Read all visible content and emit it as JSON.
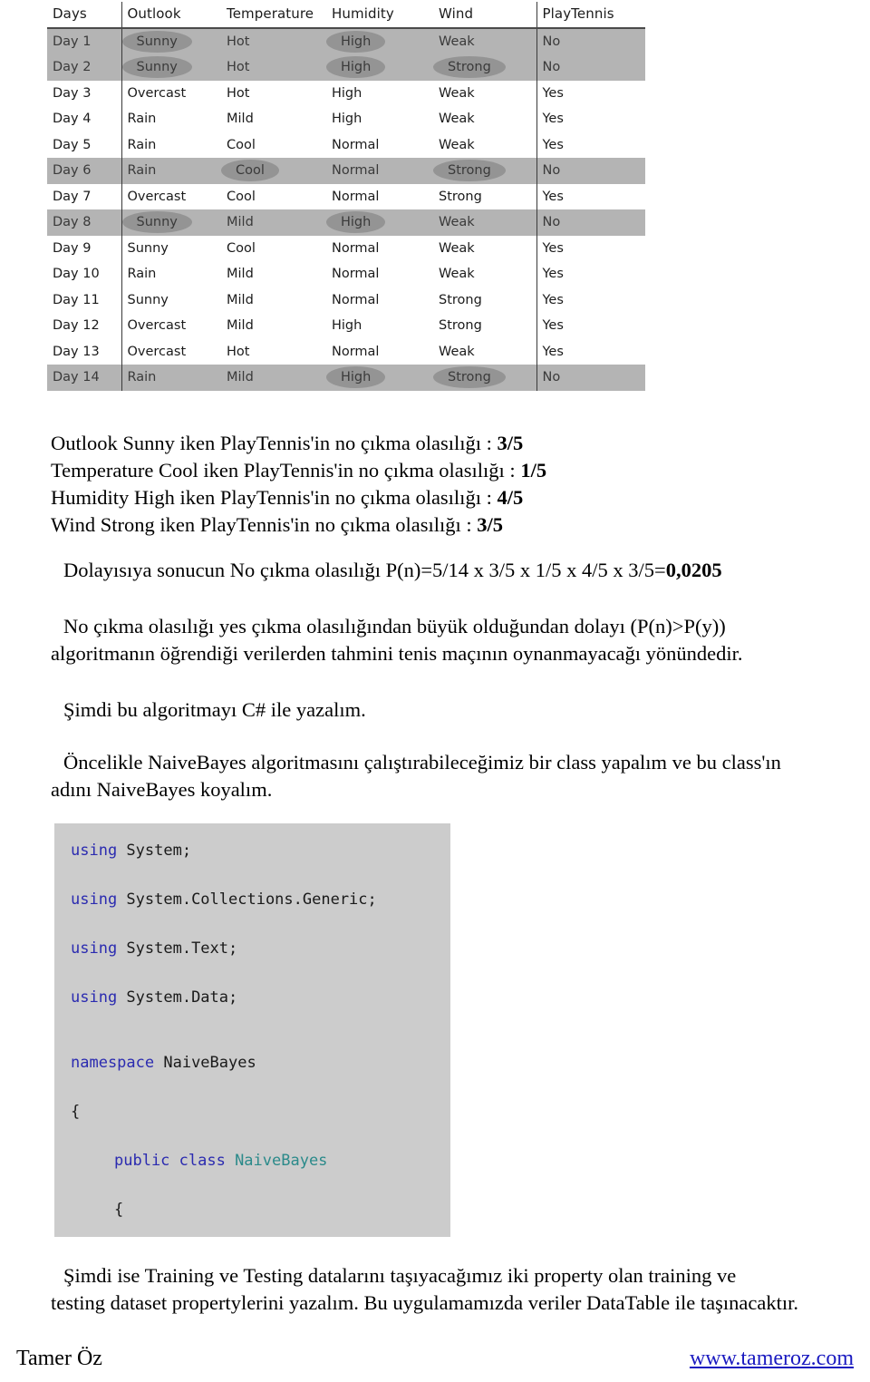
{
  "table": {
    "name": "play-tennis-dataset",
    "columns": [
      "Days",
      "Outlook",
      "Temperature",
      "Humidity",
      "Wind",
      "PlayTennis"
    ],
    "rows": [
      {
        "day": "Day 1",
        "outlook": "Sunny",
        "temperature": "Hot",
        "humidity": "High",
        "wind": "Weak",
        "play": "No",
        "highlight": true,
        "circled": [
          "outlook",
          "humidity"
        ]
      },
      {
        "day": "Day 2",
        "outlook": "Sunny",
        "temperature": "Hot",
        "humidity": "High",
        "wind": "Strong",
        "play": "No",
        "highlight": true,
        "circled": [
          "outlook",
          "humidity",
          "wind"
        ]
      },
      {
        "day": "Day 3",
        "outlook": "Overcast",
        "temperature": "Hot",
        "humidity": "High",
        "wind": "Weak",
        "play": "Yes",
        "highlight": false,
        "circled": []
      },
      {
        "day": "Day 4",
        "outlook": "Rain",
        "temperature": "Mild",
        "humidity": "High",
        "wind": "Weak",
        "play": "Yes",
        "highlight": false,
        "circled": []
      },
      {
        "day": "Day 5",
        "outlook": "Rain",
        "temperature": "Cool",
        "humidity": "Normal",
        "wind": "Weak",
        "play": "Yes",
        "highlight": false,
        "circled": []
      },
      {
        "day": "Day 6",
        "outlook": "Rain",
        "temperature": "Cool",
        "humidity": "Normal",
        "wind": "Strong",
        "play": "No",
        "highlight": true,
        "circled": [
          "temperature",
          "wind"
        ]
      },
      {
        "day": "Day 7",
        "outlook": "Overcast",
        "temperature": "Cool",
        "humidity": "Normal",
        "wind": "Strong",
        "play": "Yes",
        "highlight": false,
        "circled": []
      },
      {
        "day": "Day 8",
        "outlook": "Sunny",
        "temperature": "Mild",
        "humidity": "High",
        "wind": "Weak",
        "play": "No",
        "highlight": true,
        "circled": [
          "outlook",
          "humidity"
        ]
      },
      {
        "day": "Day 9",
        "outlook": "Sunny",
        "temperature": "Cool",
        "humidity": "Normal",
        "wind": "Weak",
        "play": "Yes",
        "highlight": false,
        "circled": []
      },
      {
        "day": "Day 10",
        "outlook": "Rain",
        "temperature": "Mild",
        "humidity": "Normal",
        "wind": "Weak",
        "play": "Yes",
        "highlight": false,
        "circled": []
      },
      {
        "day": "Day 11",
        "outlook": "Sunny",
        "temperature": "Mild",
        "humidity": "Normal",
        "wind": "Strong",
        "play": "Yes",
        "highlight": false,
        "circled": []
      },
      {
        "day": "Day 12",
        "outlook": "Overcast",
        "temperature": "Mild",
        "humidity": "High",
        "wind": "Strong",
        "play": "Yes",
        "highlight": false,
        "circled": []
      },
      {
        "day": "Day 13",
        "outlook": "Overcast",
        "temperature": "Hot",
        "humidity": "Normal",
        "wind": "Weak",
        "play": "Yes",
        "highlight": false,
        "circled": []
      },
      {
        "day": "Day 14",
        "outlook": "Rain",
        "temperature": "Mild",
        "humidity": "High",
        "wind": "Strong",
        "play": "No",
        "highlight": true,
        "circled": [
          "humidity",
          "wind"
        ]
      }
    ]
  },
  "facts": [
    {
      "text": "Outlook Sunny iken PlayTennis'in no çıkma olasılığı : ",
      "value": "3/5"
    },
    {
      "text": "Temperature Cool iken PlayTennis'in no çıkma olasılığı : ",
      "value": "1/5"
    },
    {
      "text": "Humidity High iken PlayTennis'in no çıkma olasılığı : ",
      "value": "4/5"
    },
    {
      "text": "Wind Strong iken PlayTennis'in no çıkma olasılığı : ",
      "value": "3/5"
    }
  ],
  "conclusion": {
    "text": "Dolayısıya sonucun No çıkma olasılığı P(n)=5/14 x 3/5 x 1/5 x 4/5 x 3/5=",
    "result": "0,0205"
  },
  "comparison": {
    "line1": "No çıkma olasılığı yes çıkma olasılığından büyük olduğundan dolayı (P(n)>P(y))",
    "line2": "algoritmanın öğrendiği verilerden tahmini tenis maçının oynanmayacağı yönündedir."
  },
  "now_csharp": "Şimdi bu algoritmayı C# ile yazalım.",
  "first_class": {
    "line1": "Öncelikle NaiveBayes algoritmasını çalıştırabileceğimiz bir class yapalım ve bu class'ın",
    "line2": "adını NaiveBayes koyalım."
  },
  "code": {
    "lines": [
      {
        "kw": "using ",
        "rest": "System;"
      },
      {
        "kw": "using ",
        "rest": "System.Collections.Generic;"
      },
      {
        "kw": "using ",
        "rest": "System.Text;"
      },
      {
        "kw": "using ",
        "rest": "System.Data;"
      },
      {
        "kw": "namespace ",
        "rest": "NaiveBayes"
      },
      {
        "kw": "",
        "rest": "{"
      },
      {
        "kw": "public class ",
        "rest": "NaiveBayes",
        "type": true
      },
      {
        "kw": "",
        "rest": "{"
      }
    ]
  },
  "closing": {
    "line1": "Şimdi ise Training ve Testing datalarını taşıyacağımız iki property olan training ve",
    "line2": "testing dataset propertylerini yazalım. Bu uygulamamızda veriler DataTable ile taşınacaktır."
  },
  "footer": {
    "author": "Tamer Öz",
    "site": "www.tameroz.com"
  },
  "colors": {
    "highlight_row": "#b4b4b4",
    "oval_mark": "#949494",
    "code_bg": "#cccccc",
    "keyword": "#2b2bb0",
    "type_name": "#2b8a8a",
    "link": "#1a1ac0"
  }
}
